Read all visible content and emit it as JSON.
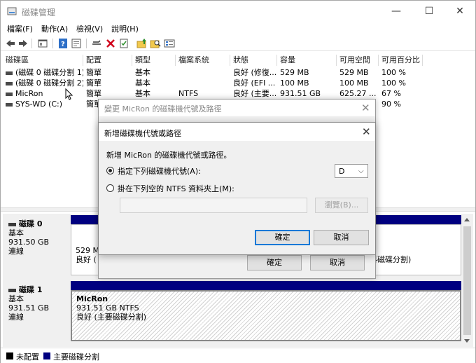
{
  "window": {
    "title": "磁碟管理",
    "minimize": "—",
    "maximize": "☐",
    "close": "✕"
  },
  "menu": [
    "檔案(F)",
    "動作(A)",
    "檢視(V)",
    "說明(H)"
  ],
  "toolbar_icons": [
    "back-icon",
    "forward-icon",
    "console-icon",
    "help-icon",
    "properties-icon",
    "connect-icon",
    "delete-icon",
    "check-icon",
    "folder-up-icon",
    "search-folder-icon",
    "list-icon"
  ],
  "volume_table": {
    "headers": [
      "磁碟區",
      "配置",
      "類型",
      "檔案系統",
      "狀態",
      "容量",
      "可用空間",
      "可用百分比"
    ],
    "rows": [
      [
        "(磁碟 0 磁碟分割 1)",
        "簡單",
        "基本",
        "",
        "良好 (修復...",
        "529 MB",
        "529 MB",
        "100 %"
      ],
      [
        "(磁碟 0 磁碟分割 2)",
        "簡單",
        "基本",
        "",
        "良好 (EFI ...",
        "100 MB",
        "100 MB",
        "100 %"
      ],
      [
        "MicRon",
        "簡單",
        "基本",
        "NTFS",
        "良好 (主要...",
        "931.51 GB",
        "625.27 ...",
        "67 %"
      ],
      [
        "SYS-WD (C:)",
        "簡單",
        "",
        "",
        "",
        "",
        "",
        "90 %"
      ]
    ]
  },
  "disks": [
    {
      "name": "磁碟 0",
      "type": "基本",
      "size": "931.50 GB",
      "status": "連線",
      "partitions": [
        {
          "name": "",
          "size": "529 MI",
          "status": "良好 (",
          "hatched": false
        },
        {
          "name": "",
          "size": "",
          "status": "料磁碟分割)",
          "hatched": false
        }
      ]
    },
    {
      "name": "磁碟 1",
      "type": "基本",
      "size": "931.51 GB",
      "status": "連線",
      "partitions": [
        {
          "name": "MicRon",
          "size": "931.51 GB NTFS",
          "status": "良好 (主要磁碟分割)",
          "hatched": true
        }
      ]
    }
  ],
  "legend": [
    {
      "label": "未配置",
      "color": "#000000"
    },
    {
      "label": "主要磁碟分割",
      "color": "#000080"
    }
  ],
  "change_dialog": {
    "title": "變更 MicRon 的磁碟機代號及路徑",
    "close": "✕",
    "ok": "確定",
    "cancel": "取消"
  },
  "add_dialog": {
    "title": "新增磁碟機代號或路徑",
    "close": "✕",
    "instruction": "新增 MicRon 的磁碟機代號或路徑。",
    "option_letter": "指定下列磁碟機代號(A):",
    "option_letter_selected": true,
    "drive_letter": "D",
    "option_folder": "掛在下列空的 NTFS 資料夾上(M):",
    "folder_path": "",
    "browse": "瀏覽(B)...",
    "ok": "確定",
    "cancel": "取消"
  }
}
